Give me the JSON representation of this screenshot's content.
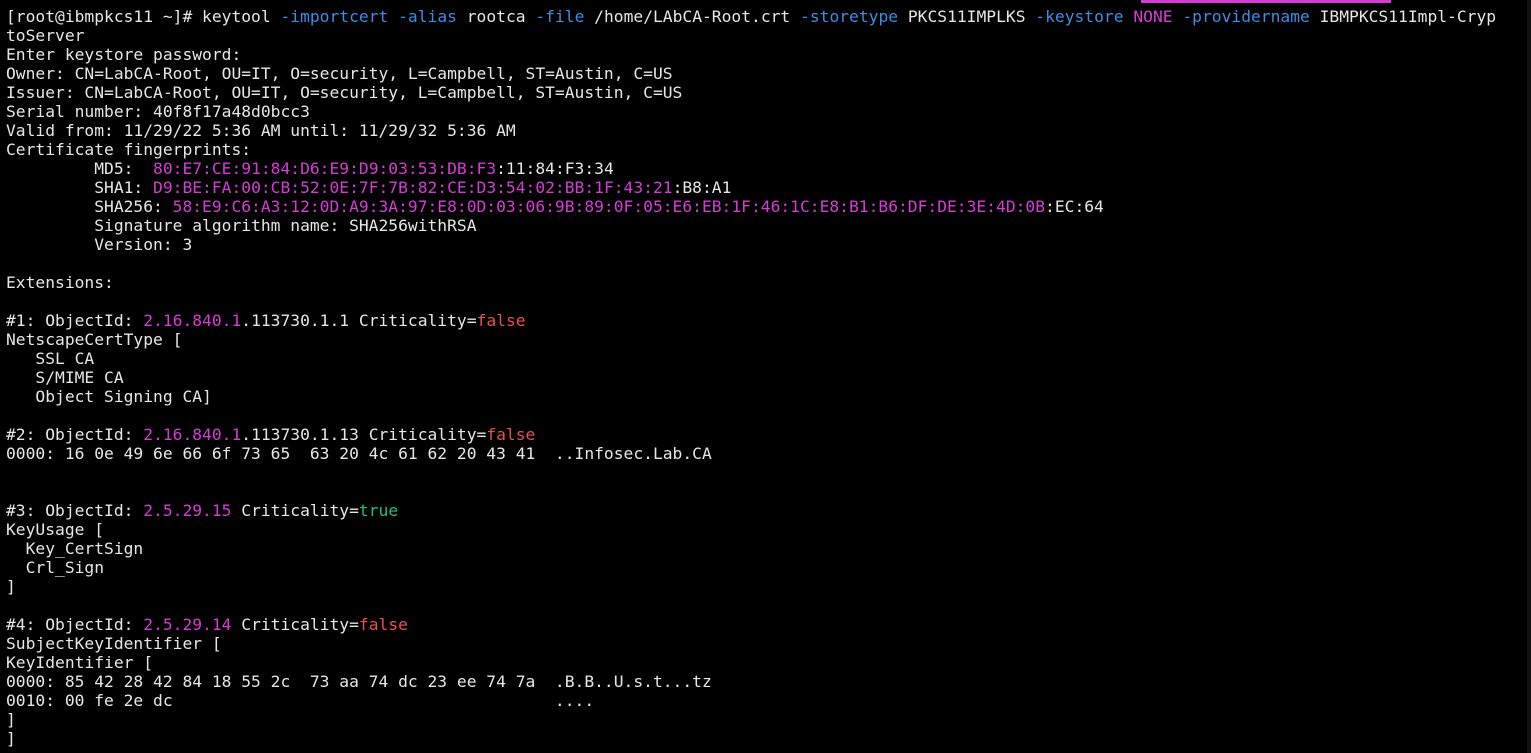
{
  "terminal": {
    "lines": [
      [
        [
          "[root@ibmpkcs11 ~]# keytool ",
          "w"
        ],
        [
          "-importcert",
          "c"
        ],
        [
          " ",
          "w"
        ],
        [
          "-alias",
          "c"
        ],
        [
          " rootca ",
          "w"
        ],
        [
          "-file",
          "c"
        ],
        [
          " /home/LAbCA-Root.crt ",
          "w"
        ],
        [
          "-storetype",
          "c"
        ],
        [
          " PKCS11IMPLKS ",
          "w"
        ],
        [
          "-keystore",
          "c"
        ],
        [
          " ",
          "w"
        ],
        [
          "NONE",
          "m"
        ],
        [
          " ",
          "w"
        ],
        [
          "-providername",
          "c"
        ],
        [
          " IBMPKCS11Impl-Cryp",
          "w"
        ]
      ],
      [
        [
          "toServer",
          "w"
        ]
      ],
      [
        [
          "Enter keystore password:",
          "w"
        ]
      ],
      [
        [
          "Owner: CN=LabCA-Root, OU=IT, O=security, L=Campbell, ST=Austin, C=US",
          "w"
        ]
      ],
      [
        [
          "Issuer: CN=LabCA-Root, OU=IT, O=security, L=Campbell, ST=Austin, C=US",
          "w"
        ]
      ],
      [
        [
          "Serial number: 40f8f17a48d0bcc3",
          "w"
        ]
      ],
      [
        [
          "Valid from: 11/29/22 5:36 AM until: 11/29/32 5:36 AM",
          "w"
        ]
      ],
      [
        [
          "Certificate fingerprints:",
          "w"
        ]
      ],
      [
        [
          "         MD5:  ",
          "w"
        ],
        [
          "80:E7:CE:91:84:D6:E9:D9:03:53:DB:F3",
          "m"
        ],
        [
          ":11:84:F3:34",
          "w"
        ]
      ],
      [
        [
          "         SHA1: ",
          "w"
        ],
        [
          "D9:BE:FA:00:CB:52:0E:7F:7B:82:CE:D3:54:02:BB:1F:43:21",
          "m"
        ],
        [
          ":B8:A1",
          "w"
        ]
      ],
      [
        [
          "         SHA256: ",
          "w"
        ],
        [
          "58:E9:C6:A3:12:0D:A9:3A:97:E8:0D:03:06:9B:89:0F:05:E6:EB:1F:46:1C:E8:B1:B6:DF:DE:3E:4D:0B",
          "m"
        ],
        [
          ":EC:64",
          "w"
        ]
      ],
      [
        [
          "         Signature algorithm name: SHA256withRSA",
          "w"
        ]
      ],
      [
        [
          "         Version: 3",
          "w"
        ]
      ],
      [
        [
          "",
          "w"
        ]
      ],
      [
        [
          "Extensions:",
          "w"
        ]
      ],
      [
        [
          "",
          "w"
        ]
      ],
      [
        [
          "#1: ObjectId: ",
          "w"
        ],
        [
          "2.16.840.1",
          "m"
        ],
        [
          ".113730.1.1 Criticality=",
          "w"
        ],
        [
          "false",
          "r"
        ]
      ],
      [
        [
          "NetscapeCertType [",
          "w"
        ]
      ],
      [
        [
          "   SSL CA",
          "w"
        ]
      ],
      [
        [
          "   S/MIME CA",
          "w"
        ]
      ],
      [
        [
          "   Object Signing CA]",
          "w"
        ]
      ],
      [
        [
          "",
          "w"
        ]
      ],
      [
        [
          "#2: ObjectId: ",
          "w"
        ],
        [
          "2.16.840.1",
          "m"
        ],
        [
          ".113730.1.13 Criticality=",
          "w"
        ],
        [
          "false",
          "r"
        ]
      ],
      [
        [
          "0000: 16 0e 49 6e 66 6f 73 65  63 20 4c 61 62 20 43 41  ..Infosec.Lab.CA",
          "w"
        ]
      ],
      [
        [
          "",
          "w"
        ]
      ],
      [
        [
          "",
          "w"
        ]
      ],
      [
        [
          "#3: ObjectId: ",
          "w"
        ],
        [
          "2.5.29.15",
          "m"
        ],
        [
          " Criticality=",
          "w"
        ],
        [
          "true",
          "g"
        ]
      ],
      [
        [
          "KeyUsage [",
          "w"
        ]
      ],
      [
        [
          "  Key_CertSign",
          "w"
        ]
      ],
      [
        [
          "  Crl_Sign",
          "w"
        ]
      ],
      [
        [
          "]",
          "w"
        ]
      ],
      [
        [
          "",
          "w"
        ]
      ],
      [
        [
          "#4: ObjectId: ",
          "w"
        ],
        [
          "2.5.29.14",
          "m"
        ],
        [
          " Criticality=",
          "w"
        ],
        [
          "false",
          "r"
        ]
      ],
      [
        [
          "SubjectKeyIdentifier [",
          "w"
        ]
      ],
      [
        [
          "KeyIdentifier [",
          "w"
        ]
      ],
      [
        [
          "0000: 85 42 28 42 84 18 55 2c  73 aa 74 dc 23 ee 74 7a  .B.B..U.s.t...tz",
          "w"
        ]
      ],
      [
        [
          "0010: 00 fe 2e dc                                       ....",
          "w"
        ]
      ],
      [
        [
          "]",
          "w"
        ]
      ],
      [
        [
          "]",
          "w"
        ]
      ]
    ]
  }
}
